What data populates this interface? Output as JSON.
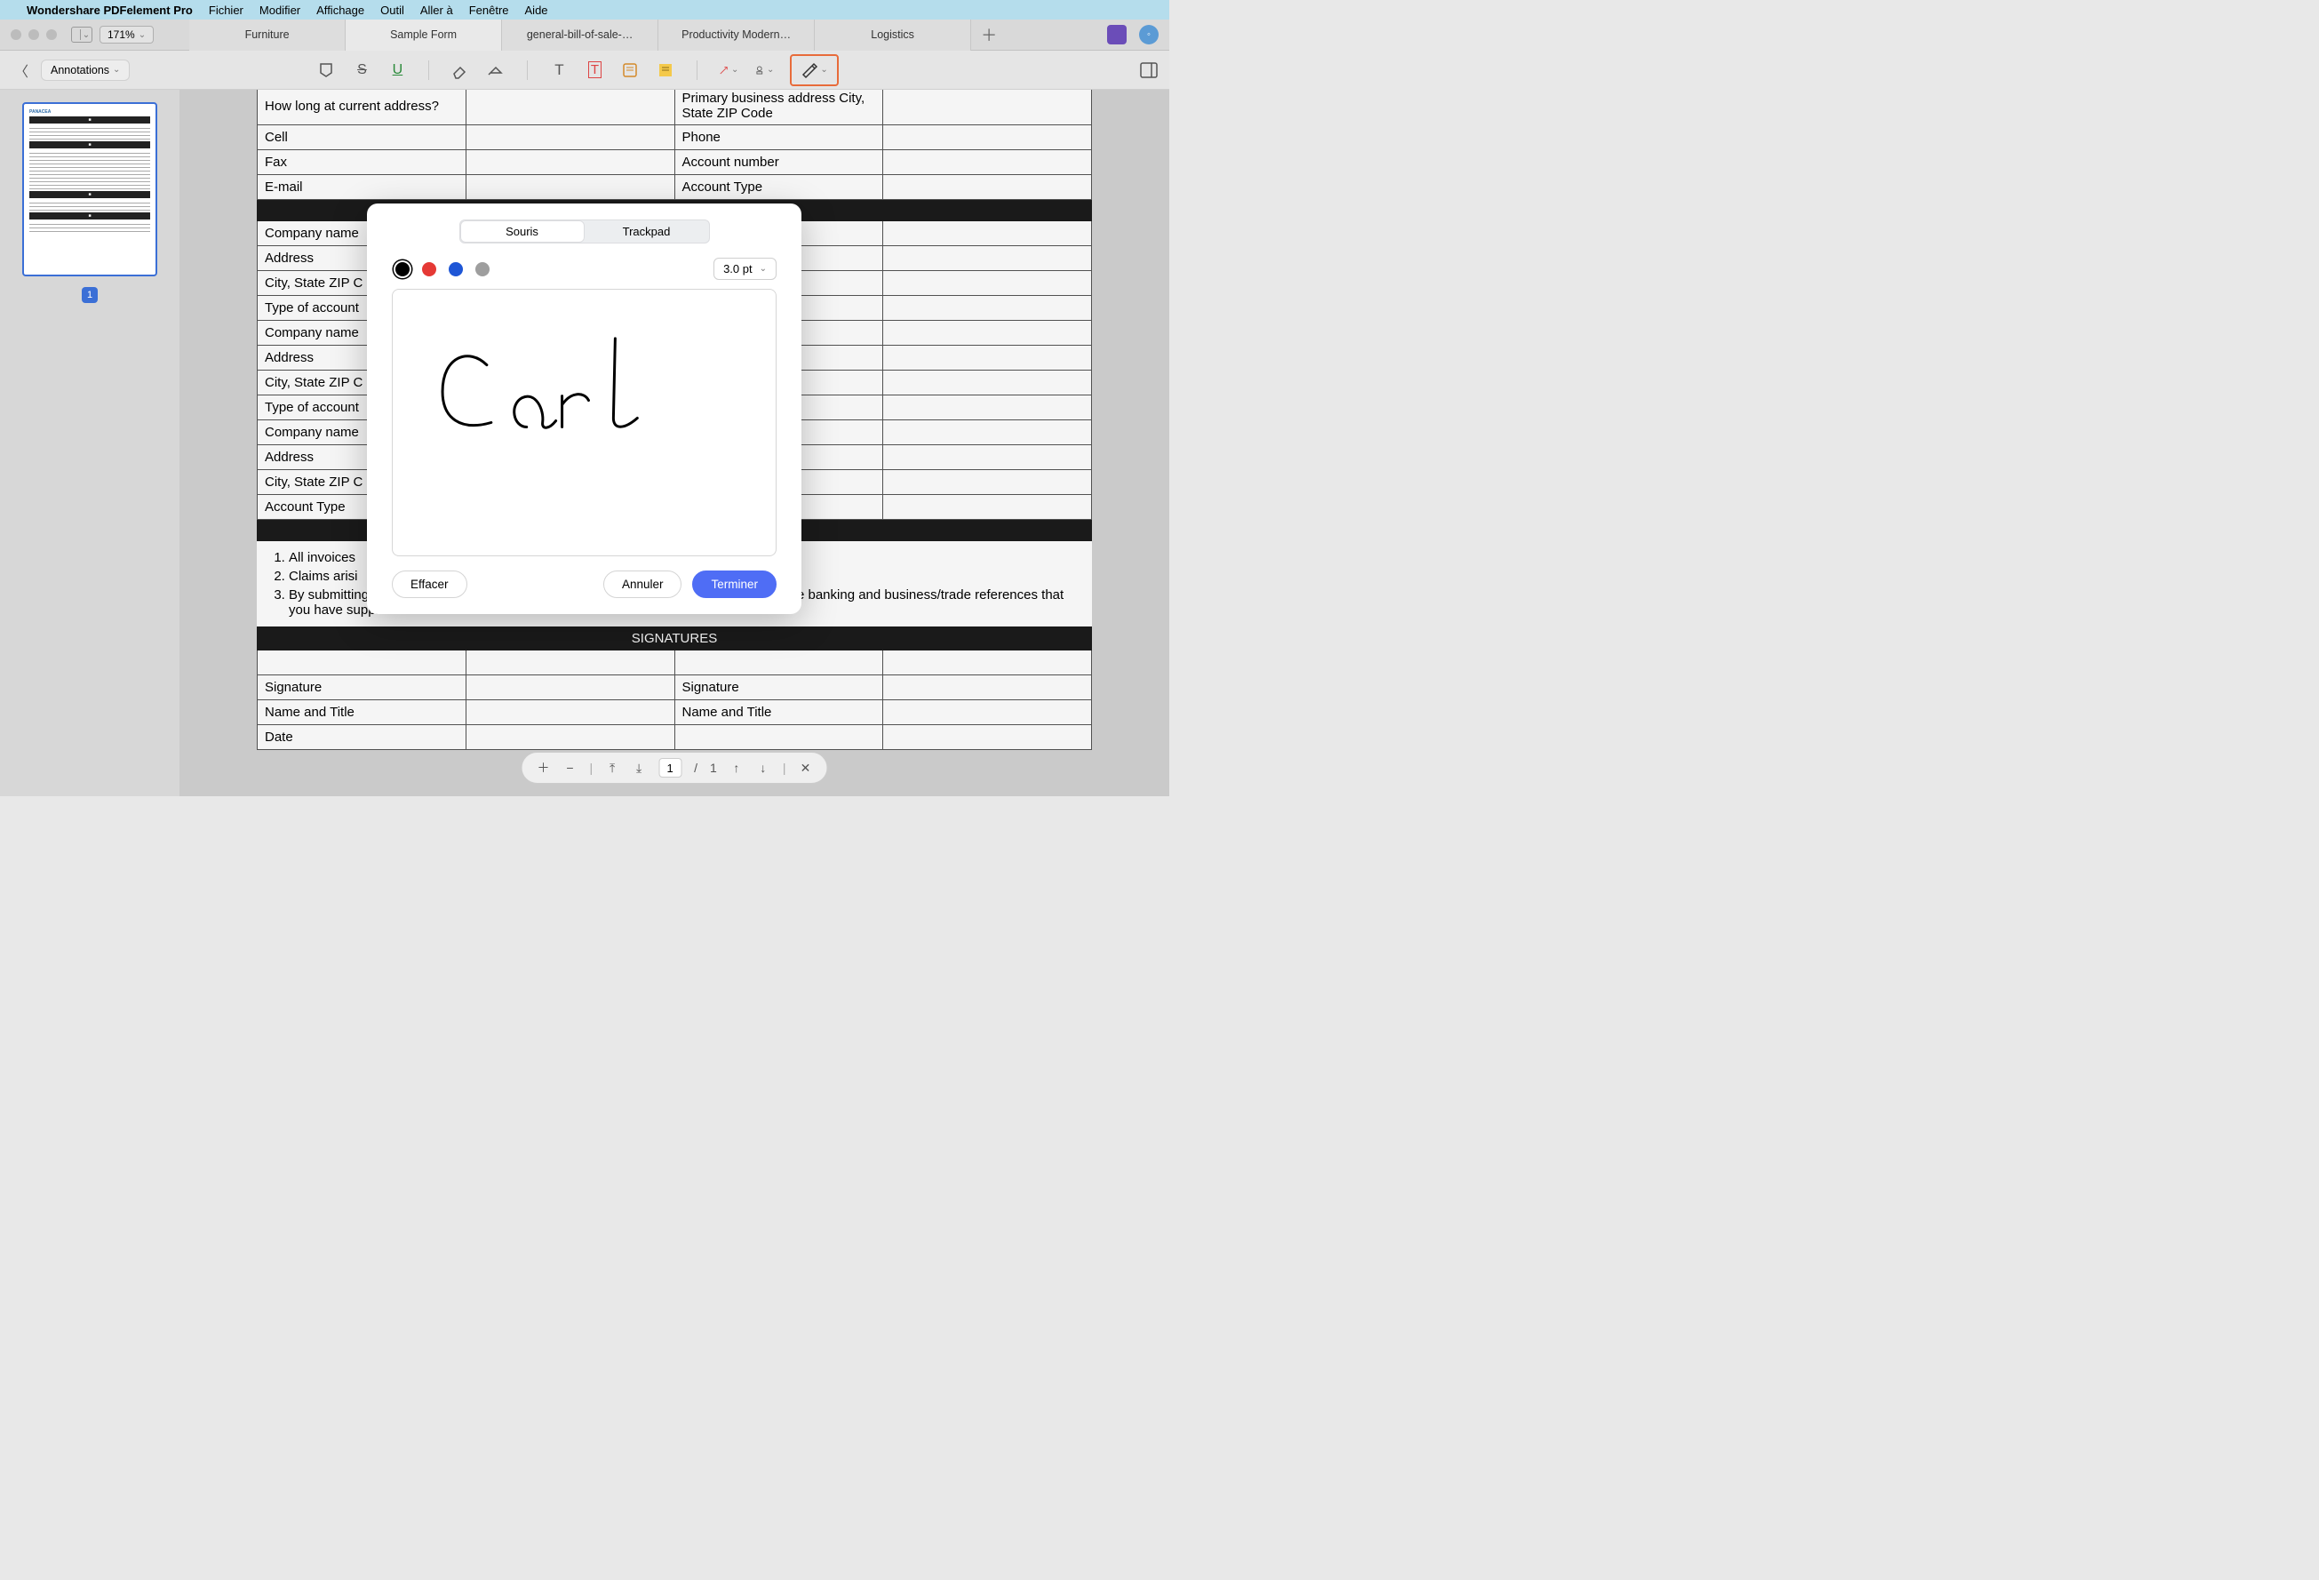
{
  "menubar": {
    "app_name": "Wondershare PDFelement Pro",
    "items": [
      "Fichier",
      "Modifier",
      "Affichage",
      "Outil",
      "Aller à",
      "Fenêtre",
      "Aide"
    ]
  },
  "window": {
    "zoom": "171%",
    "tabs": [
      "Furniture",
      "Sample Form",
      "general-bill-of-sale-…",
      "Productivity Modern…",
      "Logistics"
    ],
    "active_tab_index": 1
  },
  "toolbar": {
    "mode_label": "Annotations"
  },
  "thumbnail": {
    "page_number": "1",
    "doc_title": "PANACEA"
  },
  "form": {
    "rows_top": [
      [
        "How long at current address?",
        "Primary business address City, State ZIP Code"
      ],
      [
        "Cell",
        "Phone"
      ],
      [
        "Fax",
        "Account number"
      ],
      [
        "E-mail",
        "Account Type"
      ]
    ],
    "section1": "",
    "company_rows": [
      "Company name",
      "Address",
      "City, State ZIP C",
      "Type of account",
      "Company name",
      "Address",
      "City, State ZIP C",
      "Type of account",
      "Company name",
      "Address",
      "City, State ZIP C",
      "Account Type"
    ],
    "terms": [
      "All invoices",
      "Claims arisi",
      "By submitting this application, you authorize Alpha Resources to make inquiries into the banking and business/trade references that you have supplied."
    ],
    "sig_header": "SIGNATURES",
    "sig_rows": [
      [
        "Signature",
        "Signature"
      ],
      [
        "Name and Title",
        "Name and Title"
      ],
      [
        "Date",
        ""
      ]
    ]
  },
  "page_nav": {
    "current": "1",
    "total": "1"
  },
  "modal": {
    "tab_mouse": "Souris",
    "tab_trackpad": "Trackpad",
    "active_tab": 0,
    "colors": [
      "#000000",
      "#e53935",
      "#1e56d6",
      "#9e9e9e"
    ],
    "selected_color_index": 0,
    "thickness": "3.0 pt",
    "btn_clear": "Effacer",
    "btn_cancel": "Annuler",
    "btn_done": "Terminer",
    "signature_text": "Carl"
  }
}
